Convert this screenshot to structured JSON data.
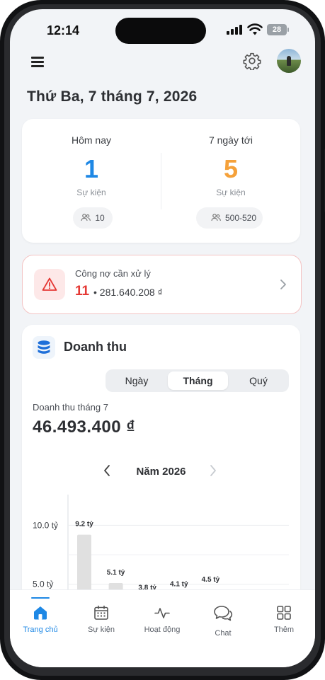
{
  "status_bar": {
    "time": "12:14",
    "battery": "28"
  },
  "header": {
    "date": "Thứ Ba, 7 tháng 7, 2026"
  },
  "stats": {
    "today": {
      "label": "Hôm nay",
      "value": "1",
      "sub": "Sự kiện",
      "guests": "10",
      "color": "#1e88e5"
    },
    "week": {
      "label": "7 ngày tới",
      "value": "5",
      "sub": "Sự kiện",
      "guests": "500-520",
      "color": "#f5a13a"
    }
  },
  "debt": {
    "label": "Công nợ cần xử lý",
    "count": "11",
    "amount": "281.640.208 ₫"
  },
  "revenue": {
    "title": "Doanh thu",
    "tabs": [
      "Ngày",
      "Tháng",
      "Quý"
    ],
    "active_tab": "Tháng",
    "period_label": "Doanh thu tháng 7",
    "total": "46.493.400 ₫",
    "year_label": "Năm 2026"
  },
  "chart_data": {
    "type": "bar",
    "categories": [
      "",
      "",
      "",
      "",
      ""
    ],
    "values": [
      9.2,
      5.1,
      3.8,
      4.1,
      4.5
    ],
    "data_labels": [
      "9.2 tỷ",
      "5.1 tỷ",
      "3.8 tỷ",
      "4.1 tỷ",
      "4.5 tỷ"
    ],
    "y_ticks": [
      10.0,
      5.0
    ],
    "y_tick_labels": [
      "10.0 tỷ",
      "5.0 tỷ"
    ],
    "ylim": [
      0,
      12
    ],
    "grid": true,
    "bar_color": "#e0e0e0"
  },
  "tabbar": {
    "items": [
      {
        "label": "Trang chủ",
        "icon": "home-icon",
        "active": true
      },
      {
        "label": "Sự kiện",
        "icon": "calendar-icon",
        "active": false
      },
      {
        "label": "Hoạt động",
        "icon": "activity-icon",
        "active": false
      },
      {
        "label": "Chat",
        "icon": "chat-icon",
        "active": false
      },
      {
        "label": "Thêm",
        "icon": "grid-icon",
        "active": false
      }
    ]
  },
  "colors": {
    "accent": "#1e88e5",
    "danger": "#e53935",
    "warning": "#f5a13a"
  }
}
